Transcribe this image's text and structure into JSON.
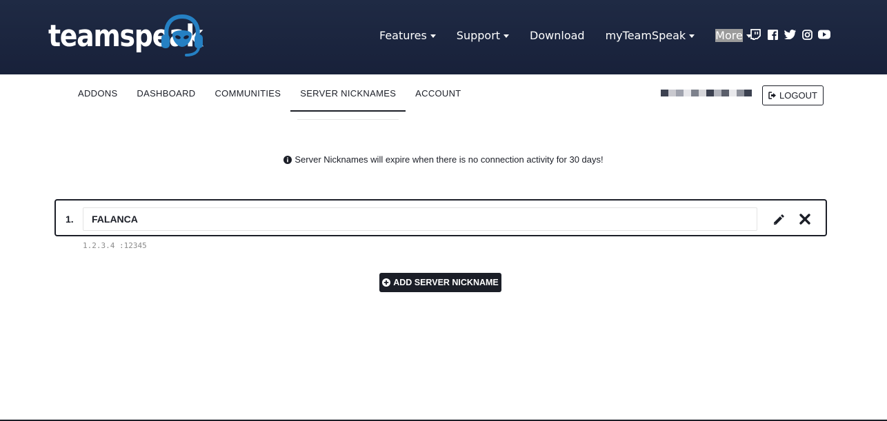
{
  "brand": {
    "logo_text": "teamspeak",
    "accent": "#2580c3"
  },
  "main_nav": {
    "items": [
      {
        "label": "Features",
        "dropdown": true
      },
      {
        "label": "Support",
        "dropdown": true
      },
      {
        "label": "Download",
        "dropdown": false
      },
      {
        "label": "myTeamSpeak",
        "dropdown": true
      },
      {
        "label": "More",
        "dropdown": true
      }
    ],
    "socials": [
      "twitch-icon",
      "facebook-icon",
      "twitter-icon",
      "instagram-icon",
      "youtube-icon"
    ]
  },
  "sub_nav": {
    "tabs": [
      {
        "label": "ADDONS"
      },
      {
        "label": "DASHBOARD"
      },
      {
        "label": "COMMUNITIES"
      },
      {
        "label": "SERVER NICKNAMES",
        "active": true
      },
      {
        "label": "ACCOUNT"
      }
    ],
    "logout_label": "LOGOUT"
  },
  "notice": {
    "text": "Server Nicknames will expire when there is no connection activity for 30 days!"
  },
  "nicknames": [
    {
      "index": "1.",
      "name": "FALANCA",
      "address": "1.2.3.4 :12345"
    }
  ],
  "add_button_label": "ADD SERVER NICKNAME",
  "colors": {
    "header_bg": "#1f2a44",
    "dark": "#1b1e27",
    "muted": "#8a8a8a"
  }
}
